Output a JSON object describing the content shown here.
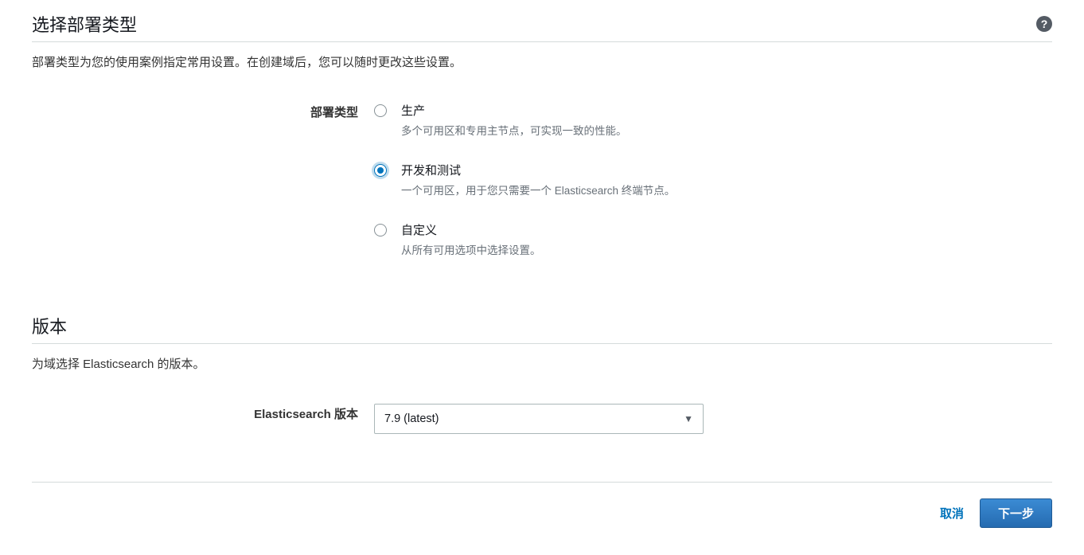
{
  "deployment": {
    "title": "选择部署类型",
    "description": "部署类型为您的使用案例指定常用设置。在创建域后，您可以随时更改这些设置。",
    "label": "部署类型",
    "options": [
      {
        "label": "生产",
        "description": "多个可用区和专用主节点，可实现一致的性能。",
        "selected": false
      },
      {
        "label": "开发和测试",
        "description": "一个可用区，用于您只需要一个 Elasticsearch 终端节点。",
        "selected": true
      },
      {
        "label": "自定义",
        "description": "从所有可用选项中选择设置。",
        "selected": false
      }
    ]
  },
  "version": {
    "title": "版本",
    "description": "为域选择 Elasticsearch 的版本。",
    "label": "Elasticsearch 版本",
    "selected": "7.9 (latest)"
  },
  "footer": {
    "cancel": "取消",
    "next": "下一步"
  },
  "icons": {
    "help": "?"
  }
}
